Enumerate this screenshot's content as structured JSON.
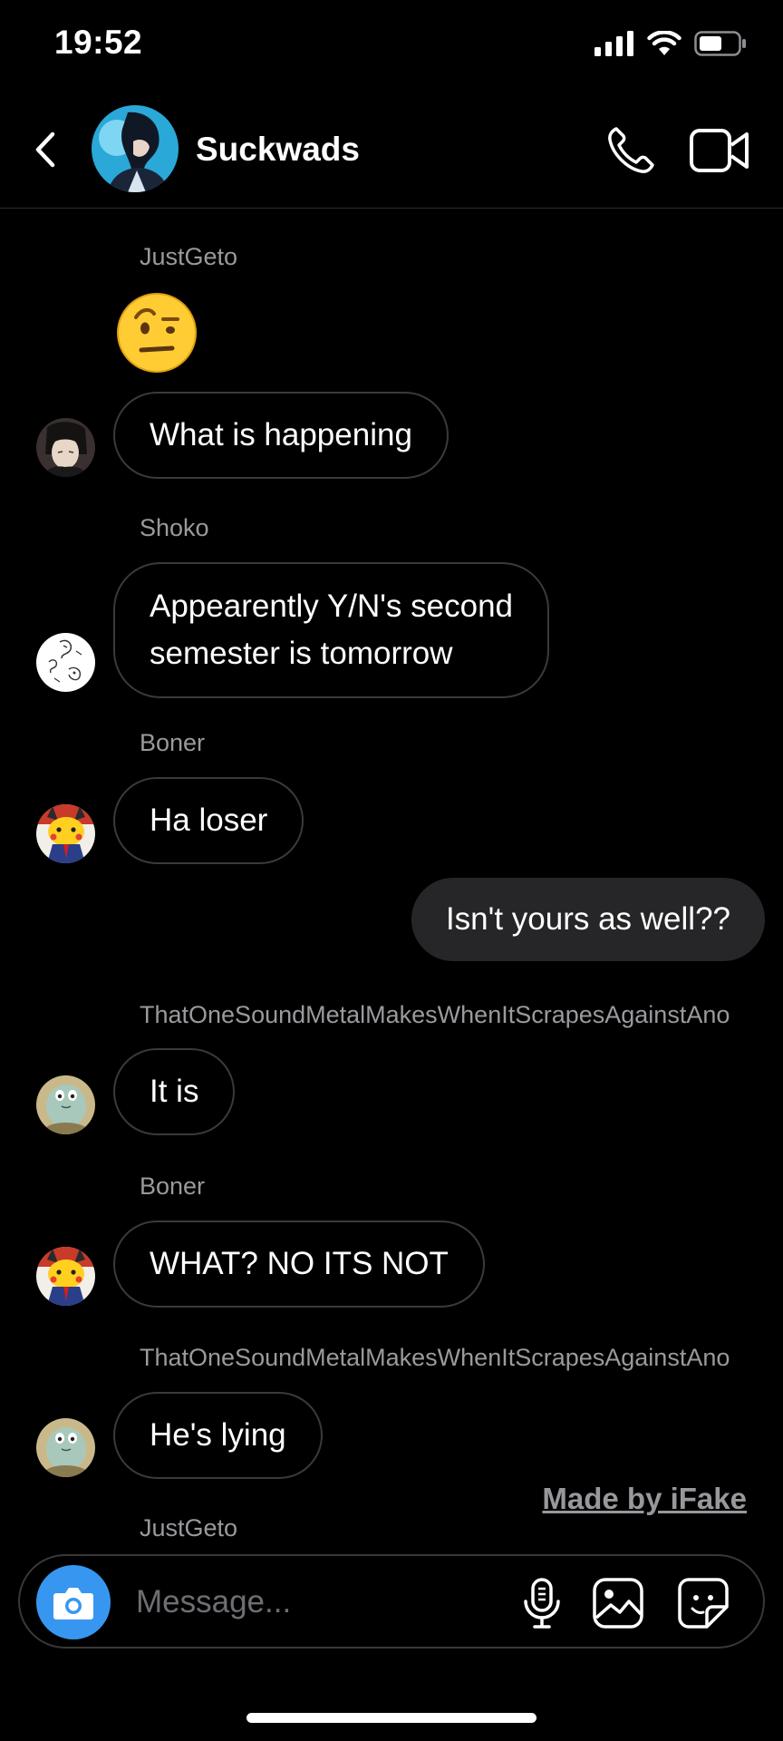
{
  "status_bar": {
    "time": "19:52"
  },
  "header": {
    "title": "Suckwads"
  },
  "messages": [
    {
      "sender": "JustGeto",
      "emoji": "face-with-raised-eyebrow",
      "text": "What is happening"
    },
    {
      "sender": "Shoko",
      "lines": [
        "Appearently Y/N's second",
        "semester is tomorrow"
      ]
    },
    {
      "sender": "Boner",
      "text": "Ha loser"
    },
    {
      "mine": true,
      "text": "Isn't yours as well??"
    },
    {
      "sender": "ThatOneSoundMetalMakesWhenItScrapesAgainstAno",
      "text": "It is"
    },
    {
      "sender": "Boner",
      "text": "WHAT? NO ITS NOT"
    },
    {
      "sender": "ThatOneSoundMetalMakesWhenItScrapesAgainstAno",
      "text": "He's lying"
    },
    {
      "sender": "JustGeto"
    }
  ],
  "watermark": "Made by iFake",
  "composer": {
    "placeholder": "Message..."
  },
  "colors": {
    "background": "#000000",
    "camera_button": "#3797f0",
    "mine_bubble": "#262628",
    "bubble_border": "#3a3a3c"
  }
}
